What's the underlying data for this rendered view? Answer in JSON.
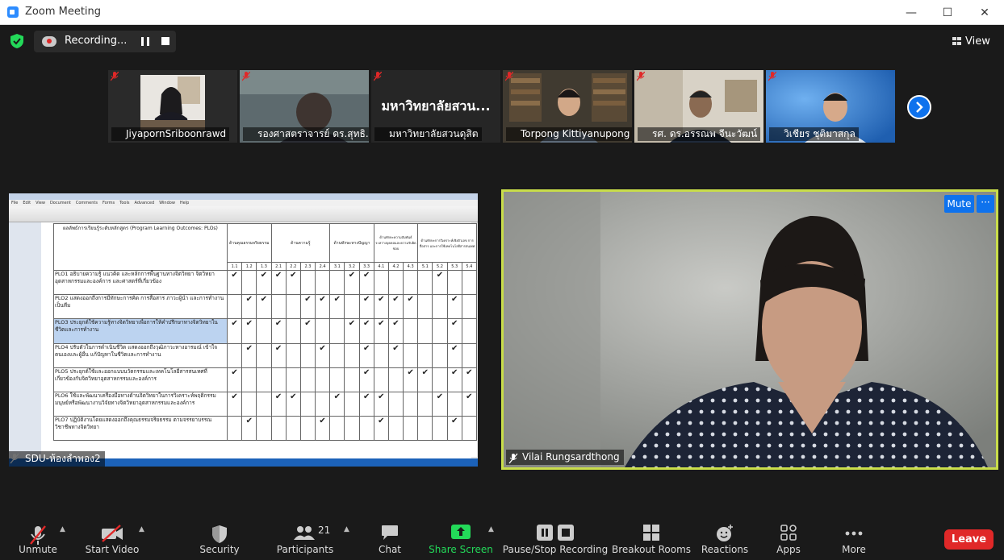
{
  "window": {
    "title": "Zoom Meeting",
    "minimize": "—",
    "maximize": "☐",
    "close": "✕"
  },
  "recording": {
    "label": "Recording..."
  },
  "view": {
    "label": "View"
  },
  "thumbnails": [
    {
      "name": "JiyapornSriboonrawd",
      "bg": "#e9e6e1"
    },
    {
      "name": "รองศาสตราจารย์ ดร.สุทธิ...",
      "bg": "#5d6a6e"
    },
    {
      "name": "มหาวิทยาลัยสวนดุสิต",
      "bg": "#262626",
      "big_text": "มหาวิทยาลัยสวน..."
    },
    {
      "name": "Torpong Kittiyanupong",
      "bg": "#403a30"
    },
    {
      "name": "รศ. ดร.อรรณพ จีนะวัฒน์",
      "bg": "#a6967c"
    },
    {
      "name": "วิเชียร ชุติมาสกุล",
      "bg": "#2a6cbf"
    }
  ],
  "share": {
    "name": "SDU-ห้องลำพอง2",
    "menu": [
      "File",
      "Edit",
      "View",
      "Document",
      "Comments",
      "Forms",
      "Tools",
      "Advanced",
      "Window",
      "Help"
    ],
    "header": "ผลลัพธ์การเรียนรู้ระดับหลักสูตร (Program Learning Outcomes: PLOs)",
    "domains": [
      "ด้านคุณธรรมจริยธรรม",
      "ด้านความรู้",
      "ด้านทักษะทางปัญญา",
      "ด้านทักษะความสัมพันธ์ระหว่างบุคคลและความรับผิดชอบ",
      "ด้านทักษะการวิเคราะห์เชิงตัวเลข การสื่อสาร และการใช้เทคโนโลยีสารสนเทศ"
    ],
    "subcols": [
      "1.1",
      "1.2",
      "1.3",
      "2.1",
      "2.2",
      "2.3",
      "2.4",
      "3.1",
      "3.2",
      "3.3",
      "4.1",
      "4.2",
      "4.3",
      "5.1",
      "5.2",
      "5.3",
      "5.4"
    ],
    "rows": [
      {
        "text": "PLO1 อธิบายความรู้ แนวคิด และหลักการพื้นฐานทางจิตวิทยา จิตวิทยาอุตสาหกรรมและองค์การ และศาสตร์ที่เกี่ยวข้อง",
        "marks": [
          1,
          0,
          1,
          1,
          1,
          0,
          0,
          0,
          1,
          1,
          0,
          0,
          0,
          0,
          1,
          0,
          0
        ]
      },
      {
        "text": "PLO2 แสดงออกถึงการมีทักษะการคิด การสื่อสาร ภาวะผู้นำ และการทำงานเป็นทีม",
        "marks": [
          0,
          1,
          1,
          0,
          0,
          1,
          1,
          1,
          0,
          1,
          1,
          1,
          1,
          0,
          0,
          1,
          0
        ]
      },
      {
        "text": "PLO3 ประยุกต์ใช้ความรู้ทางจิตวิทยาเพื่อการให้คำปรึกษาทางจิตวิทยาในชีวิตและการทำงาน",
        "marks": [
          1,
          1,
          0,
          1,
          0,
          1,
          0,
          0,
          1,
          1,
          1,
          1,
          0,
          0,
          0,
          1,
          0
        ]
      },
      {
        "text": "PLO4 ปรับตัวในการดำเนินชีวิต แสดงออกถึงวุฒิภาวะทางอารมณ์ เข้าใจตนเองและผู้อื่น แก้ปัญหาในชีวิตและการทำงาน",
        "marks": [
          0,
          1,
          0,
          1,
          0,
          0,
          1,
          0,
          0,
          1,
          0,
          1,
          0,
          0,
          0,
          1,
          0
        ]
      },
      {
        "text": "PLO5 ประยุกต์ใช้และออกแบบนวัตกรรมและเทคโนโลยีสารสนเทศที่เกี่ยวข้องกับจิตวิทยาอุตสาหกรรมและองค์การ",
        "marks": [
          1,
          0,
          0,
          0,
          0,
          0,
          0,
          0,
          0,
          1,
          0,
          0,
          1,
          1,
          0,
          1,
          1
        ]
      },
      {
        "text": "PLO6 ใช้และพัฒนาเครื่องมือทางด้านจิตวิทยาในการวิเคราะห์พฤติกรรมมนุษย์หรือพัฒนางานวิจัยทางจิตวิทยาอุตสาหกรรมและองค์การ",
        "marks": [
          1,
          0,
          0,
          1,
          1,
          0,
          0,
          1,
          0,
          1,
          1,
          0,
          0,
          0,
          1,
          0,
          1
        ]
      },
      {
        "text": "PLO7 ปฏิบัติงานโดยแสดงออกถึงคุณธรรมจริยธรรม ตามจรรยาบรรณวิชาชีพทางจิตวิทยา",
        "marks": [
          0,
          1,
          0,
          0,
          0,
          0,
          1,
          0,
          0,
          0,
          1,
          0,
          0,
          0,
          0,
          1,
          0
        ]
      }
    ]
  },
  "speaker": {
    "name": "Vilai Rungsardthong",
    "mute_label": "Mute",
    "more_label": "···"
  },
  "toolbar": {
    "unmute": "Unmute",
    "start_video": "Start Video",
    "security": "Security",
    "participants": "Participants",
    "participants_count": "21",
    "chat": "Chat",
    "share_screen": "Share Screen",
    "recording": "Pause/Stop Recording",
    "breakout": "Breakout Rooms",
    "reactions": "Reactions",
    "apps": "Apps",
    "more": "More",
    "leave": "Leave"
  },
  "colors": {
    "accent": "#0e72ed",
    "share_green": "#23d959",
    "leave_red": "#e02828",
    "active_border": "#c9dd4a"
  }
}
